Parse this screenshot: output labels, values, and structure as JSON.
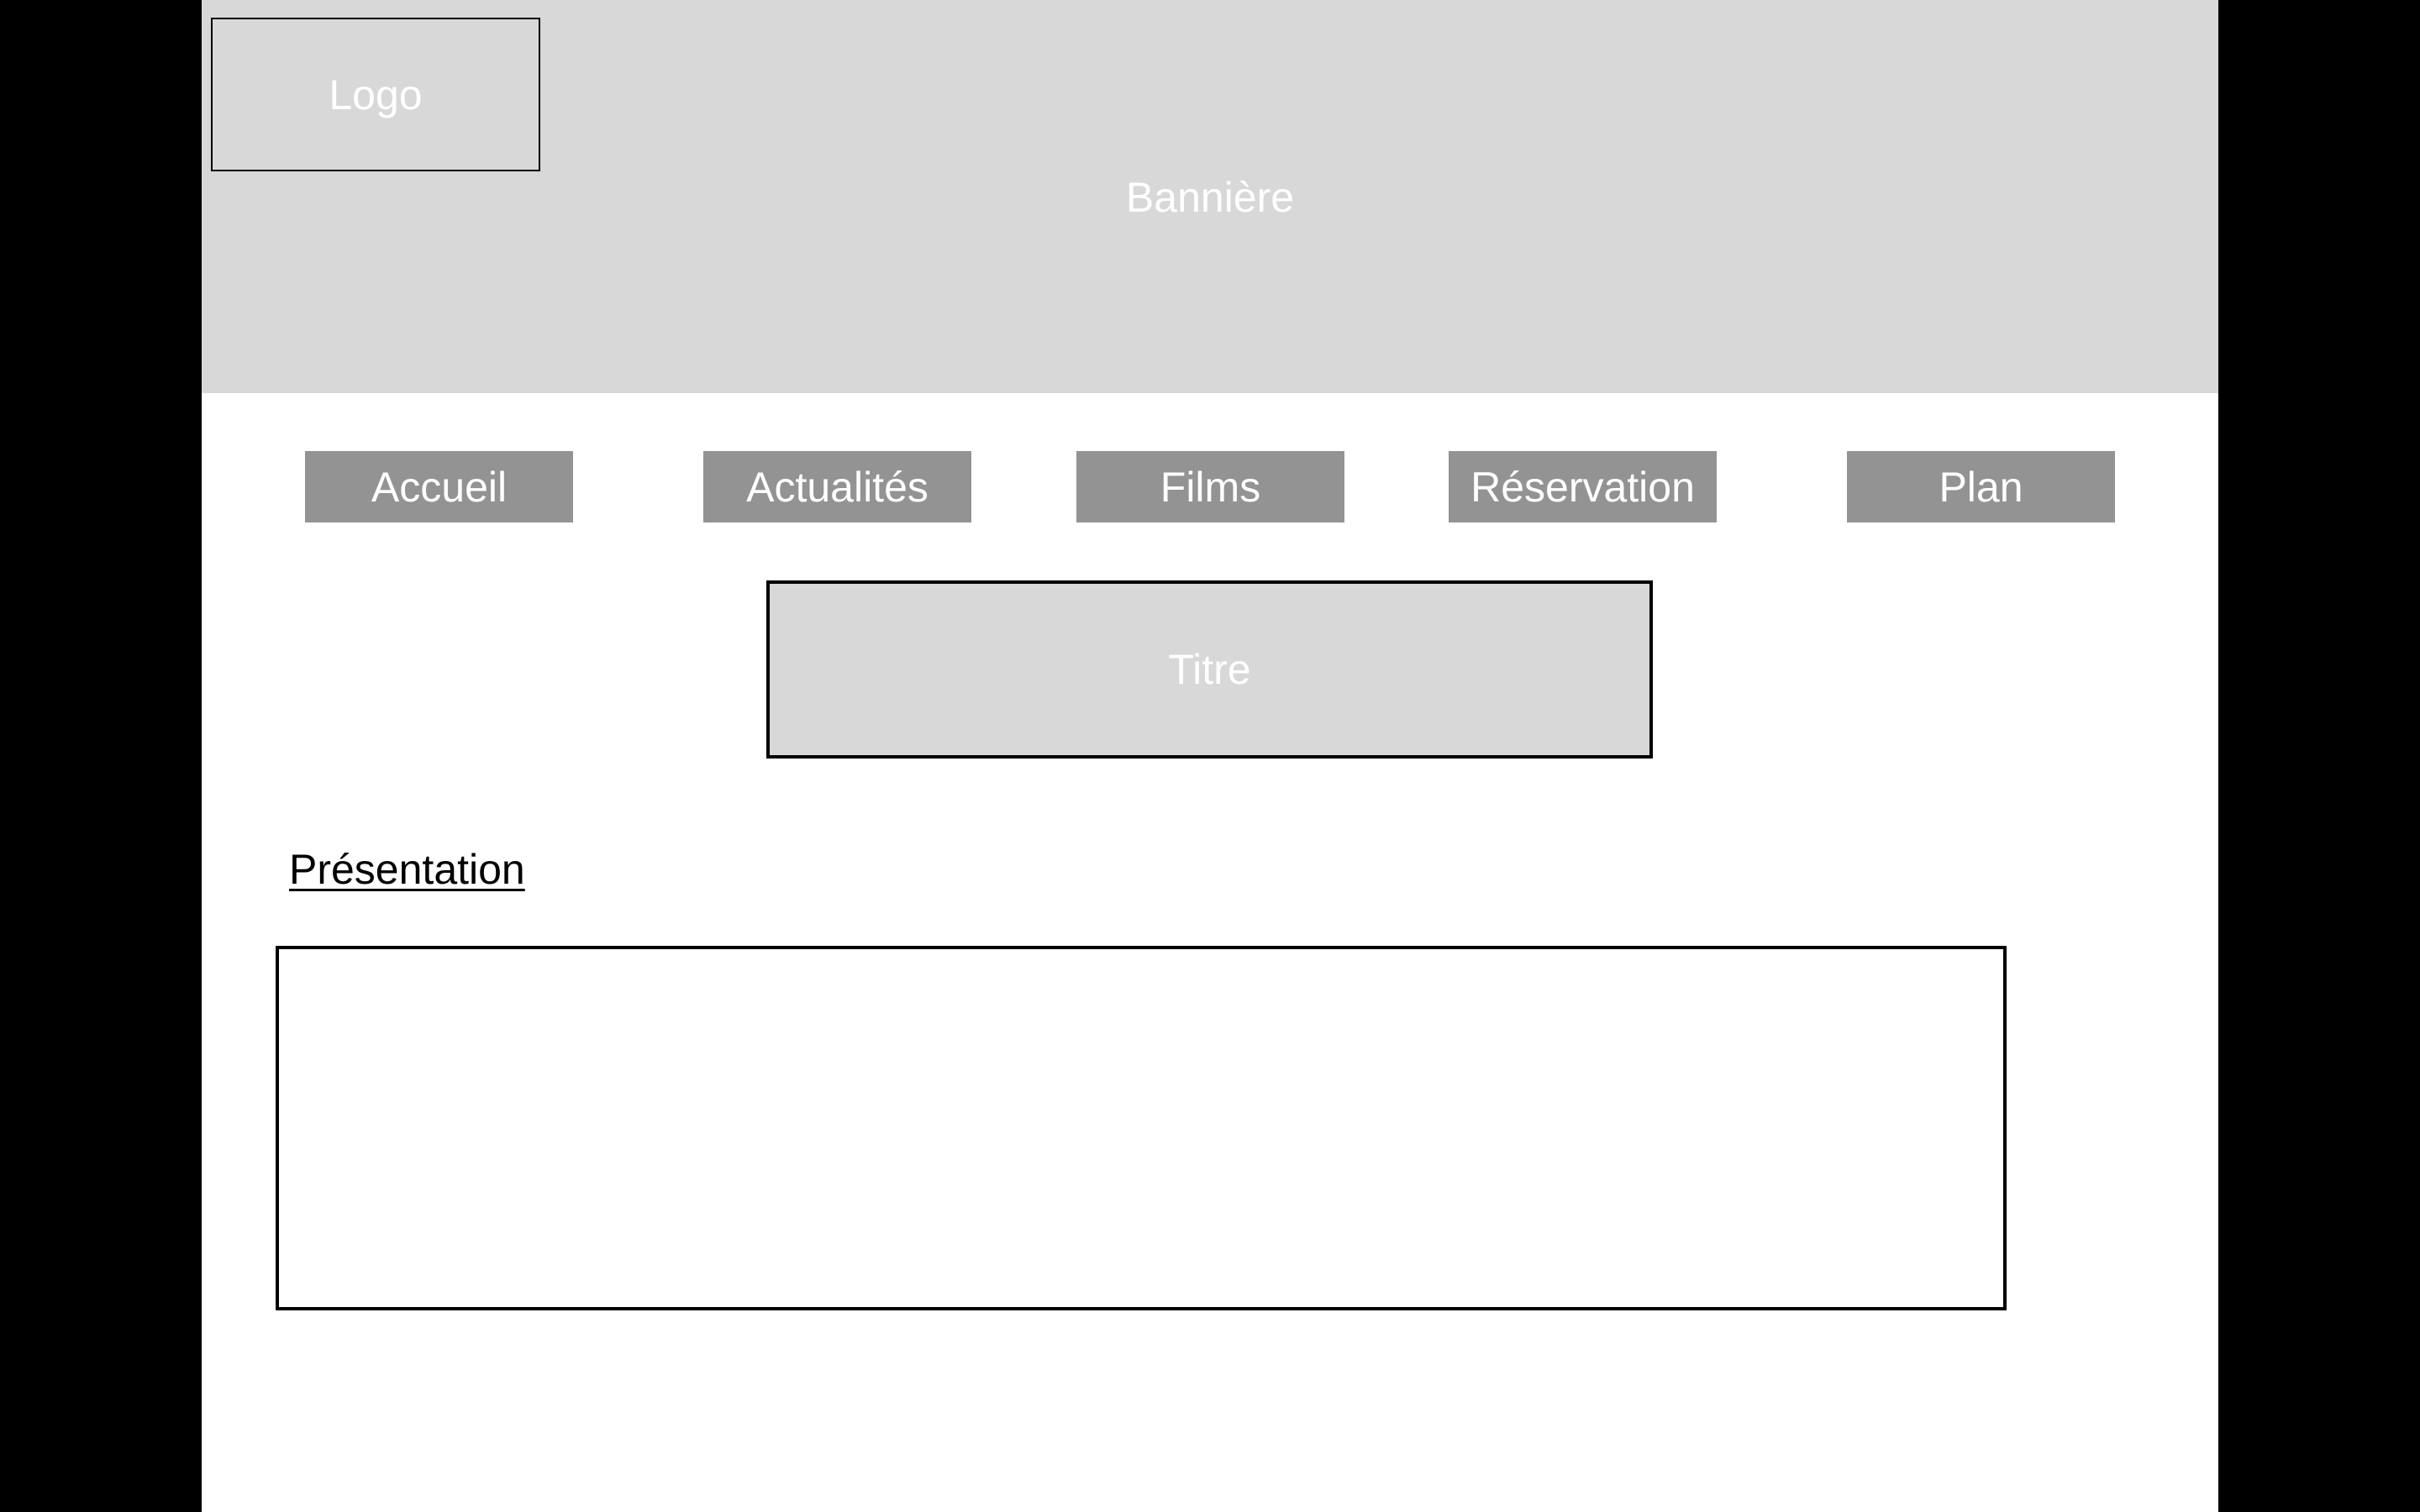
{
  "colors": {
    "outer_background": "#000000",
    "page_background": "#ffffff",
    "banner_background": "#d8d8d8",
    "nav_button_background": "#939393",
    "placeholder_text": "#ffffff",
    "border": "#000000"
  },
  "header": {
    "banner_label": "Bannière",
    "logo_label": "Logo"
  },
  "nav": {
    "items": [
      {
        "label": "Accueil"
      },
      {
        "label": "Actualités"
      },
      {
        "label": "Films"
      },
      {
        "label": "Réservation"
      },
      {
        "label": "Plan"
      }
    ]
  },
  "main": {
    "title_label": "Titre",
    "section_heading": "Présentation"
  }
}
